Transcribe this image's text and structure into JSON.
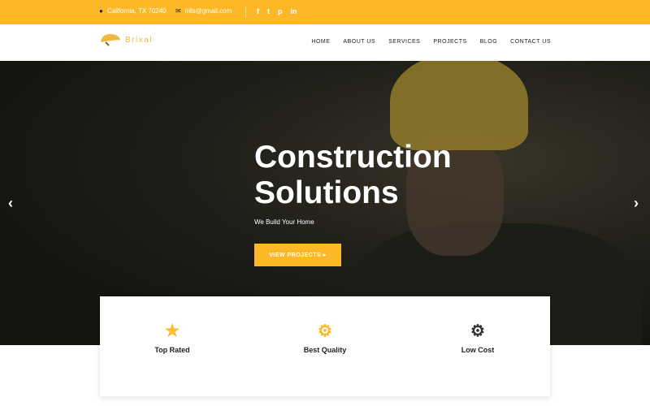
{
  "topbar": {
    "address": "California, TX 70240",
    "email": "info@gmail.com",
    "social": [
      "f",
      "t",
      "p",
      "in"
    ]
  },
  "brand": {
    "name": "Brixal",
    "accent": "#fdb827"
  },
  "nav": {
    "items": [
      "HOME",
      "ABOUT US",
      "SERVICES",
      "PROJECTS",
      "BLOG",
      "CONTACT US"
    ]
  },
  "hero": {
    "title_line1": "Construction",
    "title_line2": "Solutions",
    "subtitle": "We Build Your Home",
    "button": "VIEW PROJECTS",
    "prev": "‹",
    "next": "›"
  },
  "features": [
    {
      "label": "Top Rated",
      "icon": "star-icon"
    },
    {
      "label": "Best Quality",
      "icon": "thumbs-up-gear-icon"
    },
    {
      "label": "Low Cost",
      "icon": "coin-gear-icon"
    }
  ]
}
